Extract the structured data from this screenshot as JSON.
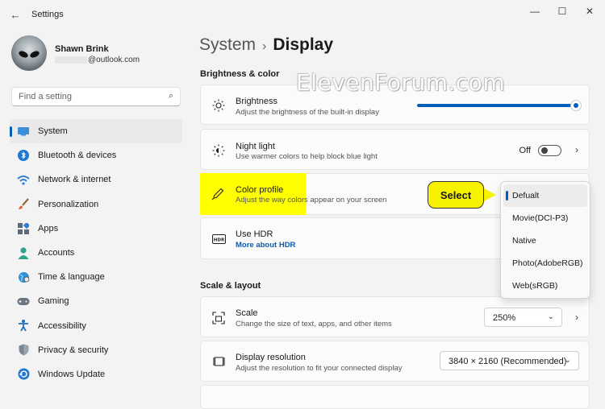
{
  "window": {
    "title": "Settings",
    "back_glyph": "←",
    "min_glyph": "—",
    "max_glyph": "☐",
    "close_glyph": "✕"
  },
  "profile": {
    "name": "Shawn Brink",
    "email": "@outlook.com"
  },
  "search": {
    "placeholder": "Find a setting",
    "icon": "⌕"
  },
  "nav": [
    {
      "label": "System",
      "icon": "system-icon",
      "active": true
    },
    {
      "label": "Bluetooth & devices",
      "icon": "bluetooth-icon"
    },
    {
      "label": "Network & internet",
      "icon": "wifi-icon"
    },
    {
      "label": "Personalization",
      "icon": "brush-icon"
    },
    {
      "label": "Apps",
      "icon": "apps-icon"
    },
    {
      "label": "Accounts",
      "icon": "person-icon"
    },
    {
      "label": "Time & language",
      "icon": "globe-icon"
    },
    {
      "label": "Gaming",
      "icon": "gamepad-icon"
    },
    {
      "label": "Accessibility",
      "icon": "accessibility-icon"
    },
    {
      "label": "Privacy & security",
      "icon": "shield-icon"
    },
    {
      "label": "Windows Update",
      "icon": "update-icon"
    }
  ],
  "breadcrumb": {
    "parent": "System",
    "separator": "›",
    "current": "Display"
  },
  "sections": {
    "brightness": "Brightness & color",
    "scale": "Scale & layout"
  },
  "brightness": {
    "title": "Brightness",
    "subtitle": "Adjust the brightness of the built-in display",
    "level_percent": 100
  },
  "night_light": {
    "title": "Night light",
    "subtitle": "Use warmer colors to help block blue light",
    "state": "Off",
    "chevron": "›"
  },
  "color_profile": {
    "title": "Color profile",
    "subtitle": "Adjust the way colors appear on your screen",
    "options": [
      "Defualt",
      "Movie(DCI-P3)",
      "Native",
      "Photo(AdobeRGB)",
      "Web(sRGB)"
    ],
    "selected_index": 0
  },
  "hdr": {
    "title": "Use HDR",
    "link": "More about HDR"
  },
  "scale": {
    "title": "Scale",
    "subtitle": "Change the size of text, apps, and other items",
    "value": "250%",
    "chevron": "›"
  },
  "resolution": {
    "title": "Display resolution",
    "subtitle": "Adjust the resolution to fit your connected display",
    "value": "3840 × 2160 (Recommended)"
  },
  "callout": {
    "label": "Select"
  },
  "watermark": "ElevenForum.com",
  "colors": {
    "accent": "#005fb8",
    "highlight": "#ffff00",
    "callout": "#f7f200"
  }
}
